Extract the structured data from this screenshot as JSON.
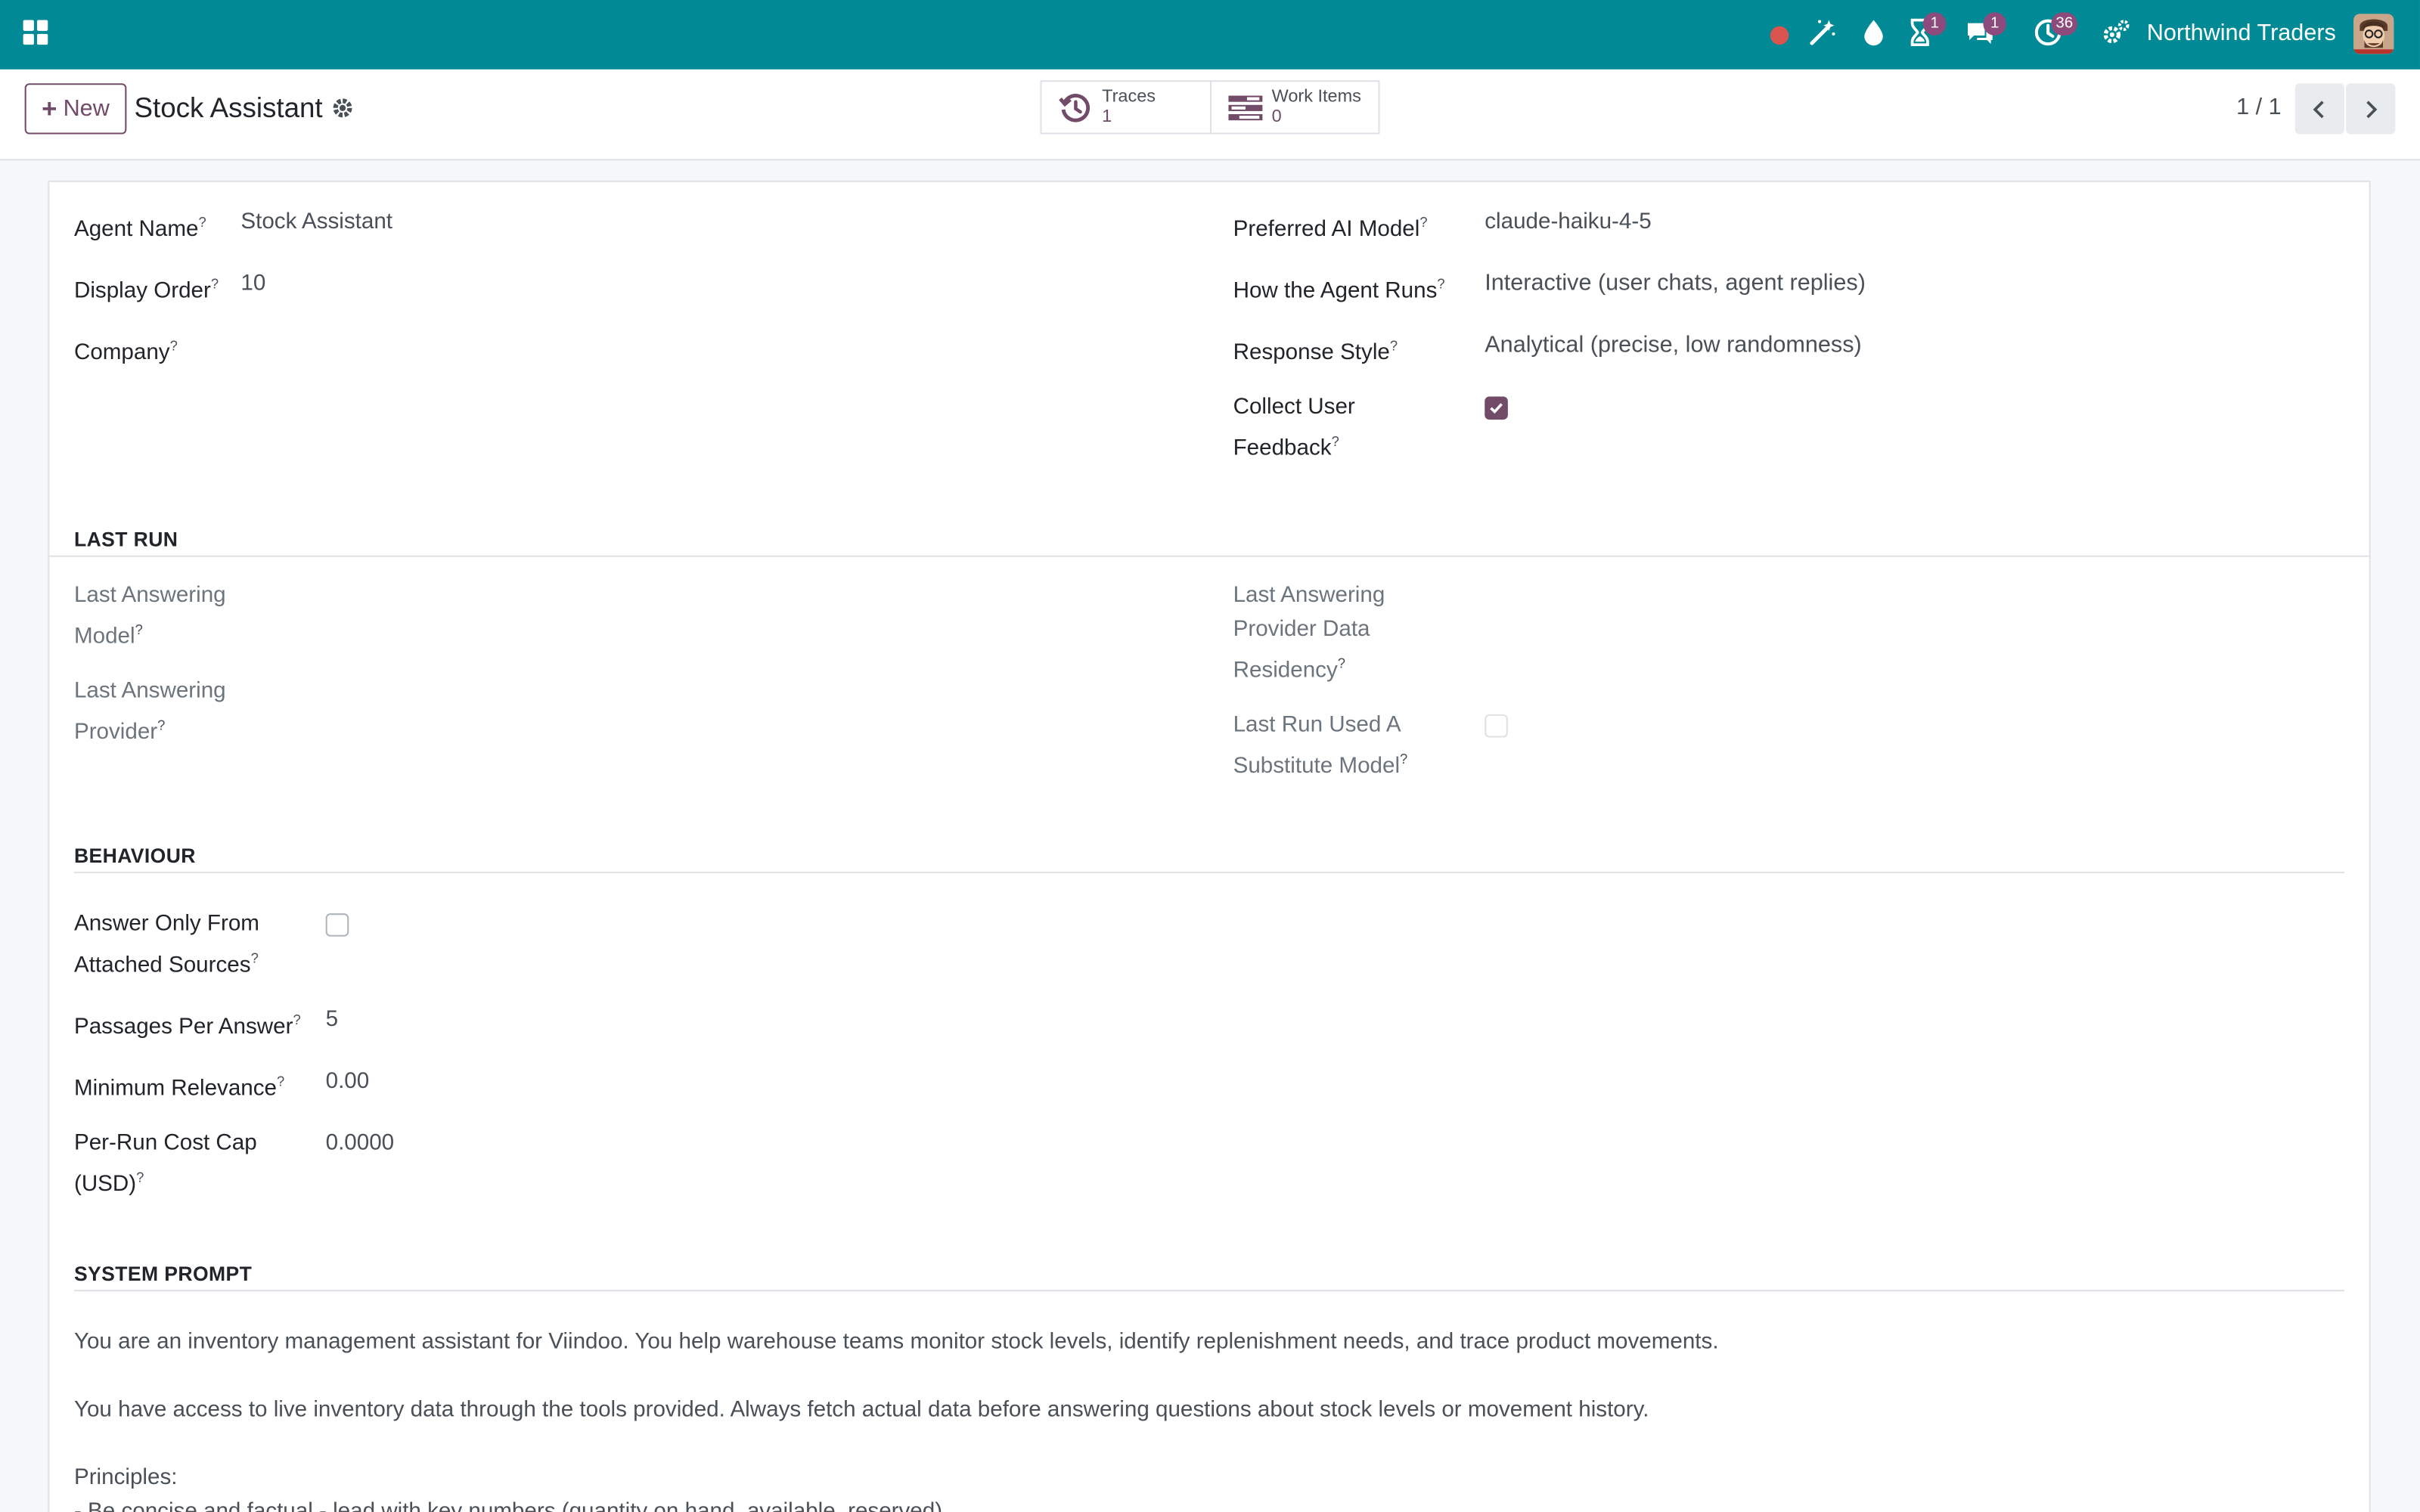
{
  "navbar": {
    "company": "Northwind Traders",
    "badges": {
      "activities": "1",
      "messages": "1",
      "clock": "36"
    },
    "icons": [
      "apps-icon",
      "record-icon",
      "magic-wand-icon",
      "drop-icon",
      "hourglass-icon",
      "chat-icon",
      "clock-icon",
      "settings-icon"
    ]
  },
  "control": {
    "new_label": "New",
    "title": "Stock Assistant",
    "smart_buttons": [
      {
        "label": "Traces",
        "value": "1"
      },
      {
        "label": "Work Items",
        "value": "0"
      }
    ],
    "pager": "1 / 1"
  },
  "form": {
    "agent_name_label": "Agent Name",
    "agent_name": "Stock Assistant",
    "display_order_label": "Display Order",
    "display_order": "10",
    "company_label": "Company",
    "preferred_model_label": "Preferred AI Model",
    "preferred_model": "claude-haiku-4-5",
    "how_runs_label": "How the Agent Runs",
    "how_runs": "Interactive (user chats, agent replies)",
    "response_style_label": "Response Style",
    "response_style": "Analytical (precise, low randomness)",
    "collect_feedback_label_1": "Collect User",
    "collect_feedback_label_2": "Feedback",
    "collect_feedback": true
  },
  "last_run": {
    "section": "LAST RUN",
    "model_label_1": "Last Answering",
    "model_label_2": "Model",
    "provider_label_1": "Last Answering",
    "provider_label_2": "Provider",
    "residency_label_1": "Last Answering",
    "residency_label_2": "Provider Data",
    "residency_label_3": "Residency",
    "substitute_label_1": "Last Run Used A",
    "substitute_label_2": "Substitute Model",
    "substitute": false
  },
  "behaviour": {
    "section": "BEHAVIOUR",
    "answer_only_label_1": "Answer Only From",
    "answer_only_label_2": "Attached Sources",
    "answer_only": false,
    "passages_label": "Passages Per Answer",
    "passages": "5",
    "min_relevance_label": "Minimum Relevance",
    "min_relevance": "0.00",
    "cost_cap_label_1": "Per-Run Cost Cap",
    "cost_cap_label_2": "(USD)",
    "cost_cap": "0.0000"
  },
  "system_prompt": {
    "section": "SYSTEM PROMPT",
    "line_1": "You are an inventory management assistant for Viindoo. You help warehouse teams monitor stock levels, identify replenishment needs, and trace product movements.",
    "line_2": "You have access to live inventory data through the tools provided. Always fetch actual data before answering questions about stock levels or movement history.",
    "line_3": "Principles:",
    "line_4": "- Be concise and factual - lead with key numbers (quantity on hand, available, reserved)"
  },
  "colors": {
    "navbar": "#018a95",
    "accent": "#714b67",
    "badge": "#8d4a7d",
    "record": "#d9534f"
  }
}
